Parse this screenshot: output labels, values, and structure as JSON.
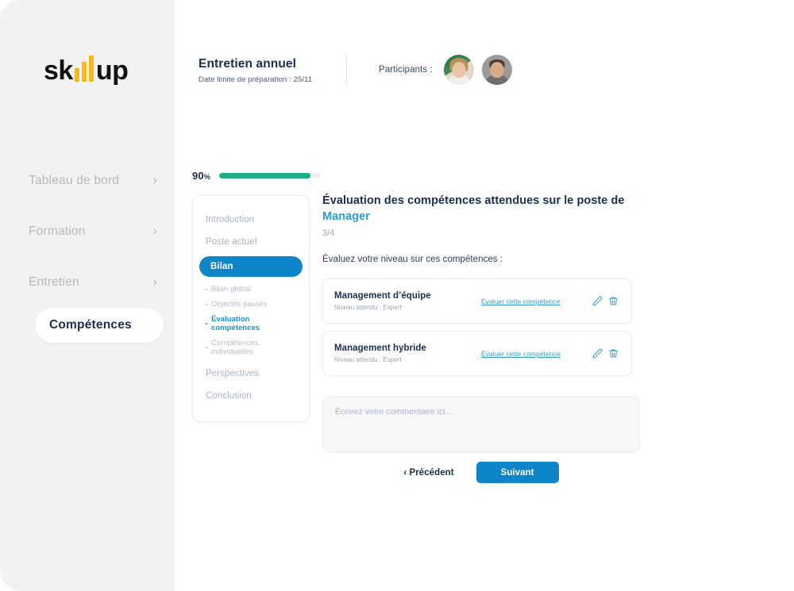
{
  "brand": {
    "name": "skillup",
    "text_before": "sk",
    "text_after": "up",
    "accent_color": "#f5b91d"
  },
  "sidebar": {
    "items": [
      {
        "label": "Tableau de bord",
        "chevron": "›",
        "active": false
      },
      {
        "label": "Formation",
        "chevron": "›",
        "active": false
      },
      {
        "label": "Entretien",
        "chevron": "›",
        "active": false
      },
      {
        "label": "Compétences",
        "chevron": "",
        "active": true
      }
    ]
  },
  "header": {
    "title": "Entretien annuel",
    "subtitle": "Date limite de préparation : 25/11",
    "participants_label": "Participants :",
    "participants": [
      {
        "name": "participant-1"
      },
      {
        "name": "participant-2"
      }
    ]
  },
  "progress": {
    "value": "90",
    "unit": "%",
    "fill_percent": 90,
    "color": "#1fae88"
  },
  "steps": {
    "items": [
      {
        "label": "Introduction",
        "active": false
      },
      {
        "label": "Poste actuel",
        "active": false
      },
      {
        "label": "Bilan",
        "active": true
      }
    ],
    "substeps": [
      {
        "label": "Bilan global",
        "active": false
      },
      {
        "label": "Objectifs passés",
        "active": false
      },
      {
        "label": "Évaluation compétences",
        "active": true
      },
      {
        "label": "Compétences individuelles",
        "active": false
      }
    ],
    "items_after": [
      {
        "label": "Perspectives",
        "active": false
      },
      {
        "label": "Conclusion",
        "active": false
      }
    ],
    "active_color": "#0e85c8"
  },
  "main": {
    "title_line1": "Évaluation des compétences attendues sur le poste",
    "title_line2_prefix": "de ",
    "title_role": "Manager",
    "counter": "3/4",
    "instruction": "Évaluez votre niveau sur ces compétences :",
    "competencies": [
      {
        "name": "Management d’équipe",
        "level": "Niveau attendu : Expert",
        "link": "Évaluer cette compétence"
      },
      {
        "name": "Management hybride",
        "level": "Niveau attendu : Expert",
        "link": "Évaluer cette compétence"
      }
    ],
    "comment_placeholder": "Écrivez votre commentaire ici..."
  },
  "footer": {
    "prev_label": "‹ Précédent",
    "next_label": "Suivant"
  }
}
